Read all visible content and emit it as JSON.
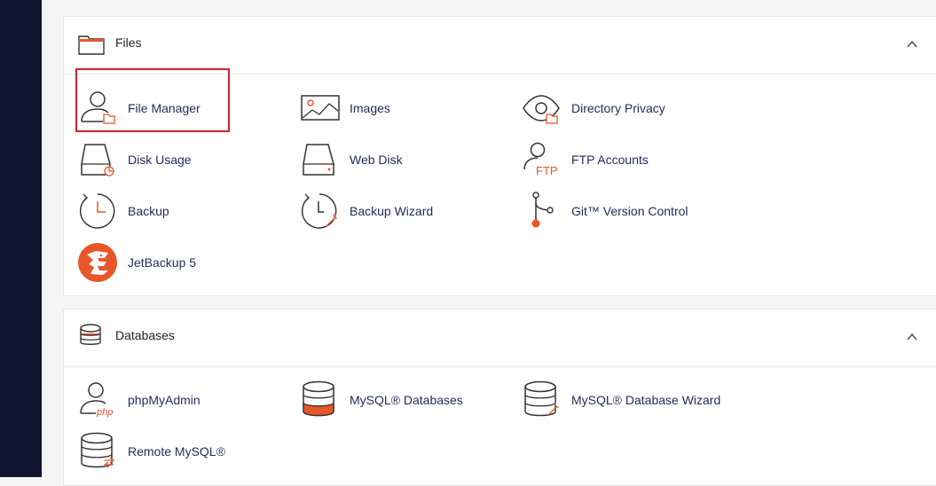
{
  "colors": {
    "sidebar": "#0f1431",
    "accent": "#e8562a",
    "link": "#1f2a5c",
    "highlight": "#d61f26"
  },
  "files": {
    "title": "Files",
    "icon": "folder-icon",
    "items": [
      {
        "label": "File Manager",
        "icon": "file-manager-icon"
      },
      {
        "label": "Images",
        "icon": "images-icon"
      },
      {
        "label": "Directory Privacy",
        "icon": "eye-folder-icon"
      },
      {
        "label": "Disk Usage",
        "icon": "disk-usage-icon"
      },
      {
        "label": "Web Disk",
        "icon": "web-disk-icon"
      },
      {
        "label": "FTP Accounts",
        "icon": "ftp-user-icon"
      },
      {
        "label": "Backup",
        "icon": "clock-icon"
      },
      {
        "label": "Backup Wizard",
        "icon": "clock-wand-icon"
      },
      {
        "label": "Git™ Version Control",
        "icon": "git-branch-icon"
      },
      {
        "label": "JetBackup 5",
        "icon": "jetbackup-logo-icon"
      }
    ]
  },
  "databases": {
    "title": "Databases",
    "icon": "database-icon",
    "items": [
      {
        "label": "phpMyAdmin",
        "icon": "php-user-icon",
        "icon_text": "php"
      },
      {
        "label": "MySQL® Databases",
        "icon": "database-icon"
      },
      {
        "label": "MySQL® Database Wizard",
        "icon": "database-wand-icon"
      },
      {
        "label": "Remote MySQL®",
        "icon": "database-remote-icon"
      }
    ]
  },
  "ftp_icon_text": "FTP"
}
